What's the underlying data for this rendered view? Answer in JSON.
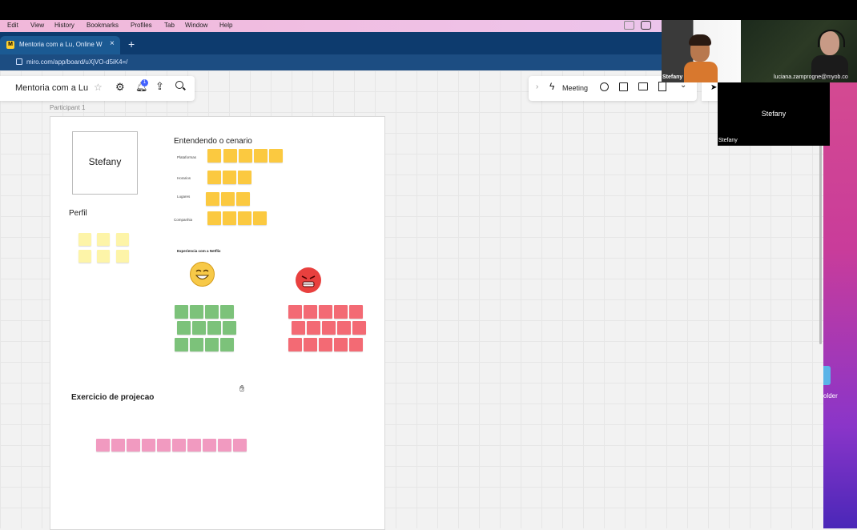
{
  "menubar": {
    "items": [
      "Edit",
      "View",
      "History",
      "Bookmarks",
      "Profiles",
      "Tab",
      "Window",
      "Help"
    ]
  },
  "browser": {
    "tab_title": "Mentoria com a Lu, Online Wh",
    "url": "miro.com/app/board/uXjVO-d5iK4=/"
  },
  "toolbar": {
    "board_name": "Mentoria com a Lu",
    "notification_count": "1",
    "meeting_label": "Meeting"
  },
  "frame": {
    "label": "Participant 1",
    "name_card": "Stefany",
    "scenario_title": "Entendendo o cenario",
    "rows": [
      "Plataformas",
      "Horarios",
      "Lugares",
      "Companhia"
    ],
    "perfil": "Perfil",
    "experience_title": "Experiencia com a Netflix",
    "projection_title": "Exercicio de projecao"
  },
  "video": {
    "participant1_name": "Stefany",
    "participant2_name": "luciana.zamprogne@myob.co",
    "placeholder_name": "Stefany",
    "placeholder_label": "Stefany"
  },
  "desktop": {
    "folder_label": "older"
  },
  "colors": {
    "yellow_sticky": "#fbc940",
    "light_yellow_sticky": "#fdf4a8",
    "green_sticky": "#7cc27a",
    "red_sticky": "#f36a74",
    "pink_sticky": "#f19ac0"
  }
}
